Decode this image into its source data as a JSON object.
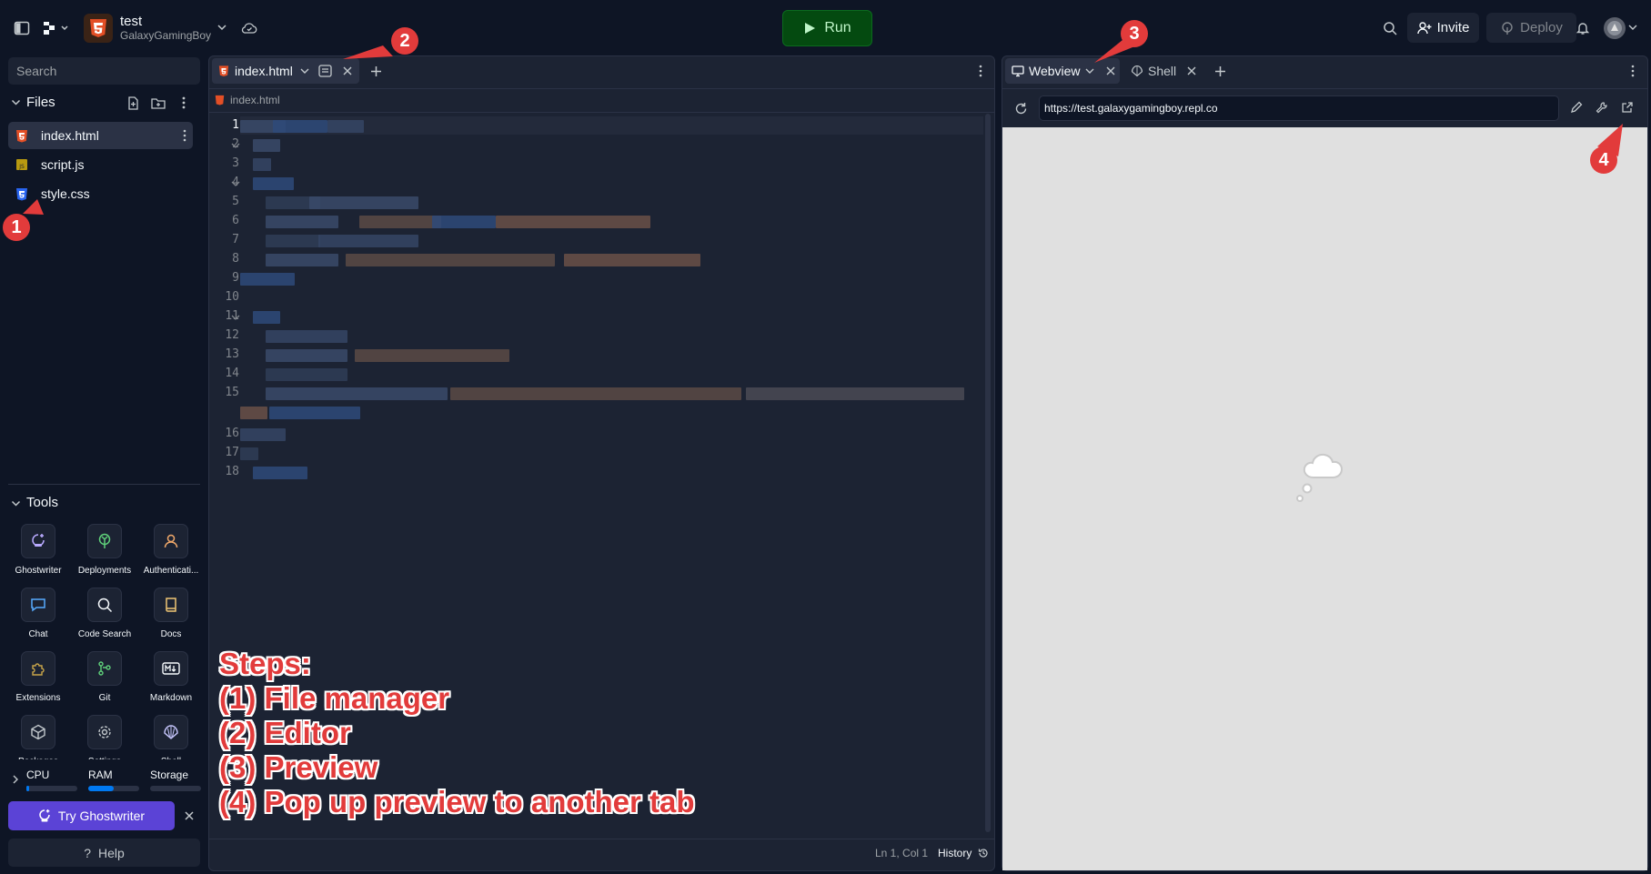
{
  "project": {
    "name": "test",
    "owner": "GalaxyGamingBoy"
  },
  "topbar": {
    "run_label": "Run",
    "invite_label": "Invite",
    "deploy_label": "Deploy"
  },
  "sidebar": {
    "search_placeholder": "Search",
    "files_title": "Files",
    "files": [
      {
        "name": "index.html",
        "icon": "html-file-icon"
      },
      {
        "name": "script.js",
        "icon": "js-file-icon"
      },
      {
        "name": "style.css",
        "icon": "css-file-icon"
      }
    ],
    "tools_title": "Tools",
    "tools": [
      {
        "label": "Ghostwriter",
        "icon": "ghostwriter-icon"
      },
      {
        "label": "Deployments",
        "icon": "deployments-icon"
      },
      {
        "label": "Authenticati...",
        "icon": "user-icon"
      },
      {
        "label": "Chat",
        "icon": "chat-icon"
      },
      {
        "label": "Code Search",
        "icon": "search-icon"
      },
      {
        "label": "Docs",
        "icon": "book-icon"
      },
      {
        "label": "Extensions",
        "icon": "puzzle-icon"
      },
      {
        "label": "Git",
        "icon": "git-icon"
      },
      {
        "label": "Markdown",
        "icon": "markdown-icon"
      },
      {
        "label": "Packages",
        "icon": "package-icon"
      },
      {
        "label": "Settings",
        "icon": "gear-icon"
      },
      {
        "label": "Shell",
        "icon": "shell-icon"
      }
    ],
    "meters": [
      {
        "label": "CPU",
        "level": 0.05
      },
      {
        "label": "RAM",
        "level": 0.5
      },
      {
        "label": "Storage",
        "level": 0.0
      }
    ],
    "ghostwriter_label": "Try Ghostwriter",
    "help_label": "Help"
  },
  "editor": {
    "tab_label": "index.html",
    "breadcrumb": "index.html",
    "line_numbers": [
      "1",
      "2",
      "3",
      "4",
      "5",
      "6",
      "7",
      "8",
      "9",
      "10",
      "11",
      "12",
      "13",
      "14",
      "15",
      "16",
      "17",
      "18"
    ],
    "status": "Ln 1, Col 1",
    "history_label": "History"
  },
  "preview": {
    "tabs": [
      {
        "label": "Webview"
      },
      {
        "label": "Shell"
      }
    ],
    "url": "https://test.galaxygamingboy.repl.co"
  },
  "annotations": {
    "badges": [
      "1",
      "2",
      "3",
      "4"
    ],
    "steps": [
      "Steps:",
      "(1) File manager",
      "(2) Editor",
      "(3) Preview",
      "(4) Pop up preview to another tab"
    ],
    "color": "#e23b3b"
  },
  "colors": {
    "background": "#0e1525",
    "panel": "#1c2333",
    "run": "#044a10",
    "ghostwriter": "#5b43d6"
  }
}
